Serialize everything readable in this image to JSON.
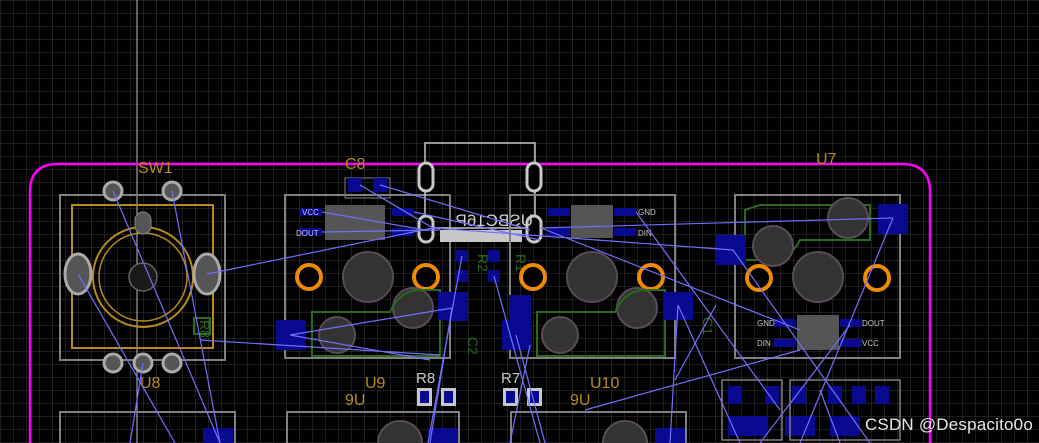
{
  "colors": {
    "background": "#000000",
    "grid": "#3a3a3a",
    "board_outline": "#ff00ff",
    "silkscreen": "#c8c8c8",
    "designator": "#b88a1a",
    "pad_smd": "#0a0a90",
    "pad_through": "#f08a00",
    "ratsnest": "#7070ff",
    "courtyard": "#808080",
    "component_body": "#2a6a1a",
    "highlight_hole": "#5a4a5a"
  },
  "designators": {
    "sw1": "SW1",
    "c8": "C8",
    "u7": "U7",
    "u8": "U8",
    "u9": "U9",
    "u10": "U10",
    "r8": "R8",
    "r7": "R7",
    "r2": "R2",
    "r1": "R1",
    "c2": "C2",
    "c1": "C1",
    "usb": "USBC16P",
    "dup_u9": "9U",
    "dup_u10": "9U"
  },
  "pin_labels": {
    "vcc": "VCC",
    "dout": "DOUT",
    "gnd": "GND",
    "din": "DIN"
  },
  "watermark": "CSDN @Despacito0o"
}
